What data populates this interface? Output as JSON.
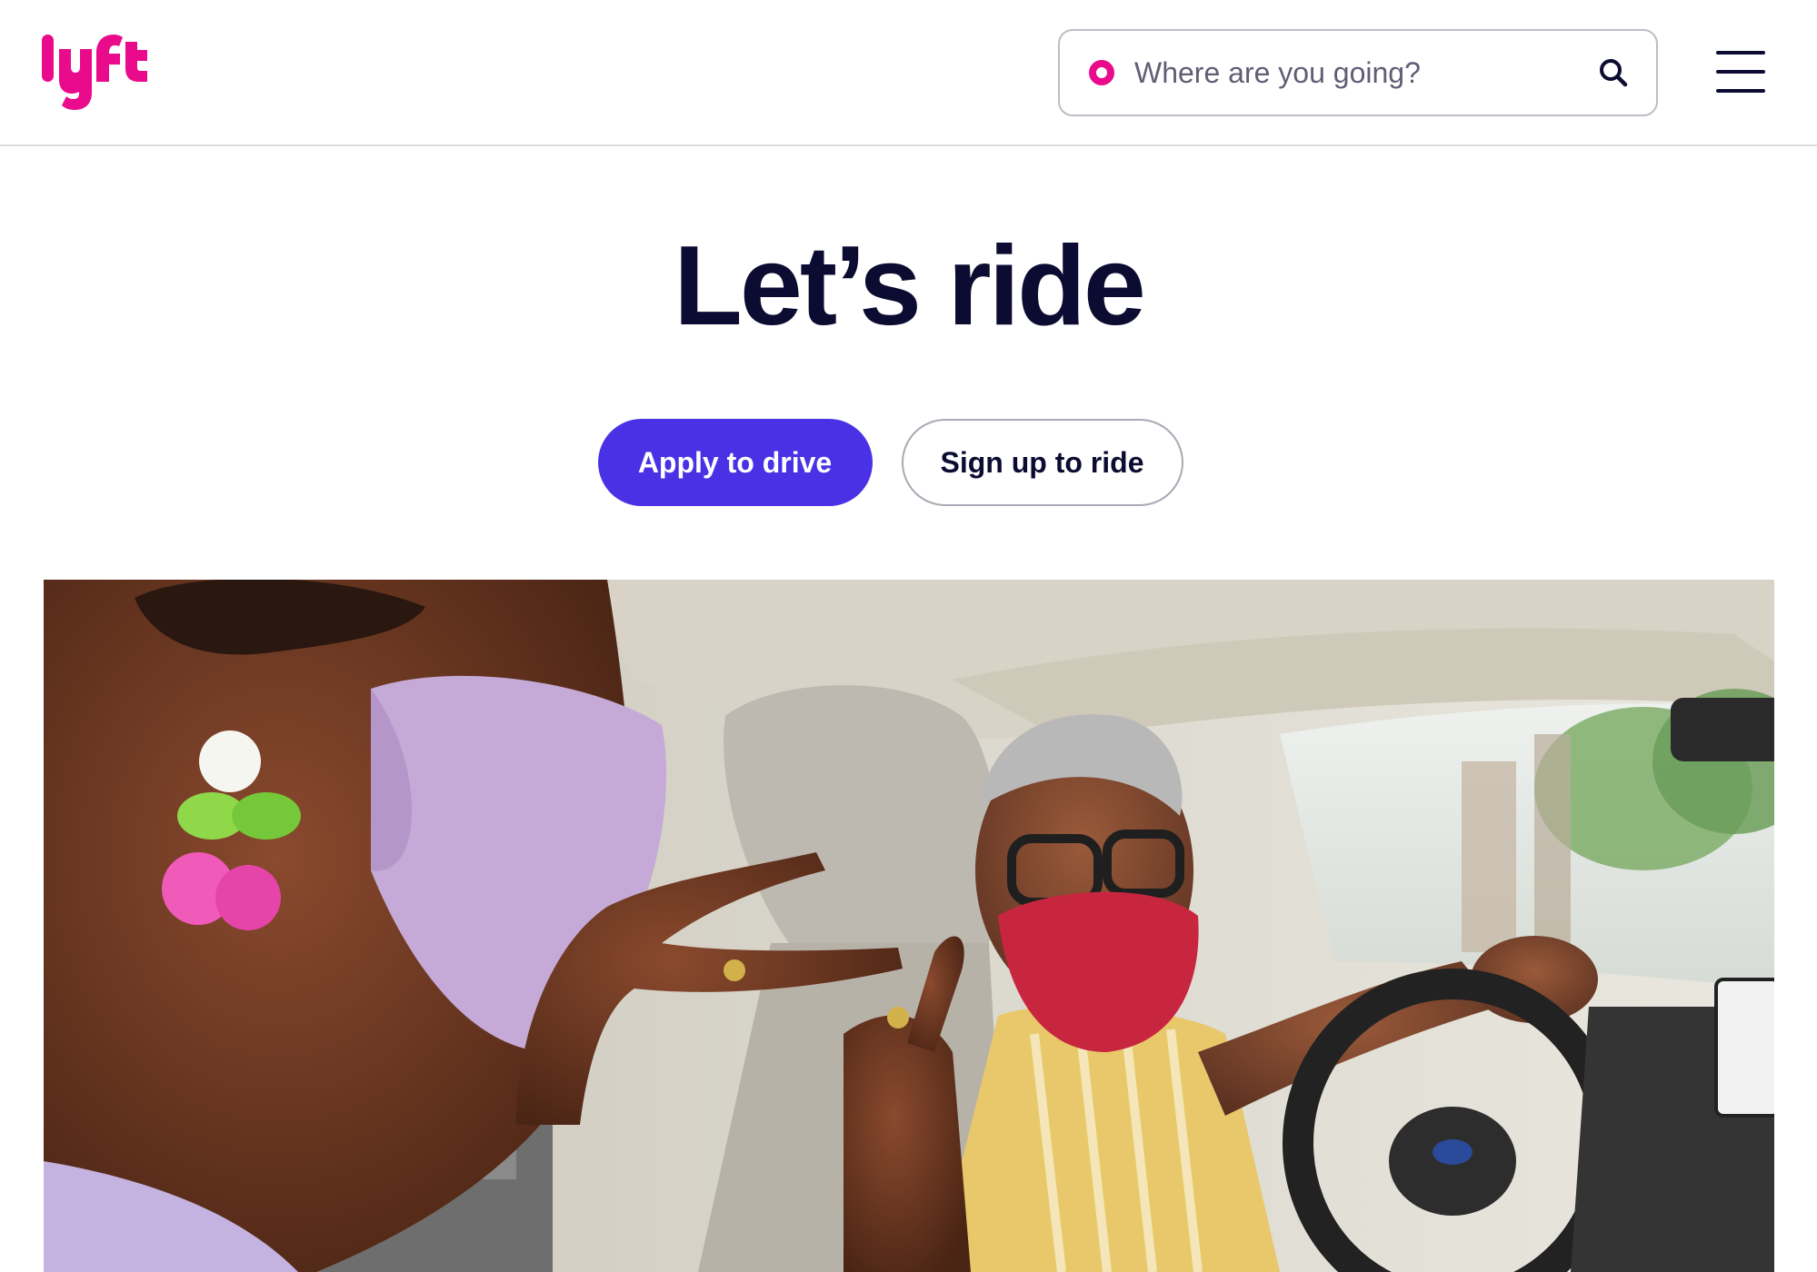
{
  "brand": {
    "logo_text": "lyft",
    "accent_color": "#ea0b8c"
  },
  "header": {
    "search": {
      "placeholder": "Where are you going?",
      "value": "",
      "pin_icon": "location-dot-icon",
      "action_icon": "search-icon"
    },
    "menu_icon": "hamburger-menu-icon"
  },
  "hero": {
    "title": "Let’s ride",
    "buttons": {
      "primary_label": "Apply to drive",
      "secondary_label": "Sign up to ride"
    },
    "primary_color": "#4a31e6"
  },
  "photo": {
    "alt": "Masked passenger talking with masked driver inside a car"
  }
}
